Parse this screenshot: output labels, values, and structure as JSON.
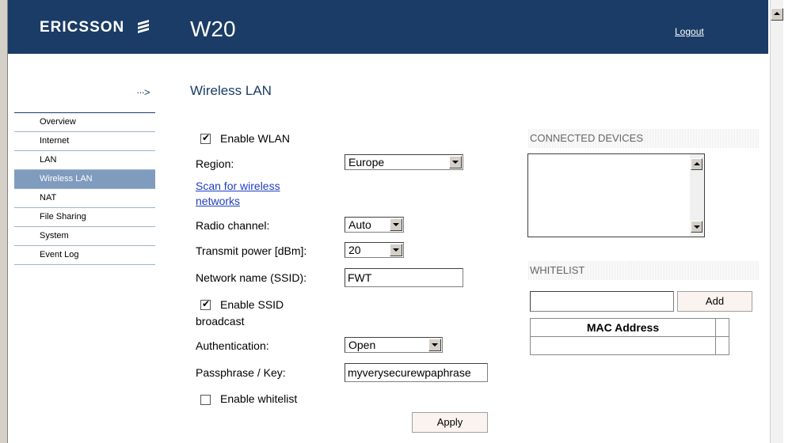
{
  "header": {
    "brand": "ERICSSON",
    "product": "W20",
    "logout": "Logout"
  },
  "page": {
    "title": "Wireless LAN",
    "arrow": "···>"
  },
  "nav": {
    "items": [
      {
        "label": "Overview"
      },
      {
        "label": "Internet"
      },
      {
        "label": "LAN"
      },
      {
        "label": "Wireless LAN",
        "active": true
      },
      {
        "label": "NAT"
      },
      {
        "label": "File Sharing"
      },
      {
        "label": "System"
      },
      {
        "label": "Event Log"
      }
    ]
  },
  "form": {
    "enable_wlan": {
      "label": "Enable WLAN",
      "checked": true
    },
    "region": {
      "label": "Region:",
      "value": "Europe"
    },
    "scan_link": {
      "line1": "Scan for wireless",
      "line2": "networks"
    },
    "radio_channel": {
      "label": "Radio channel:",
      "value": "Auto"
    },
    "transmit_power": {
      "label": "Transmit power [dBm]:",
      "value": "20"
    },
    "ssid": {
      "label": "Network name (SSID):",
      "value": "FWT"
    },
    "ssid_broadcast": {
      "line1": "Enable SSID",
      "line2": "broadcast",
      "checked": true
    },
    "authentication": {
      "label": "Authentication:",
      "value": "Open"
    },
    "passphrase": {
      "label": "Passphrase / Key:",
      "value": "myverysecurewpaphrase"
    },
    "enable_whitelist": {
      "label": "Enable whitelist",
      "checked": false
    },
    "apply": "Apply"
  },
  "connected_devices": {
    "title": "CONNECTED DEVICES"
  },
  "whitelist": {
    "title": "WHITELIST",
    "add": "Add",
    "column": "MAC Address"
  },
  "checkmark": "✔"
}
